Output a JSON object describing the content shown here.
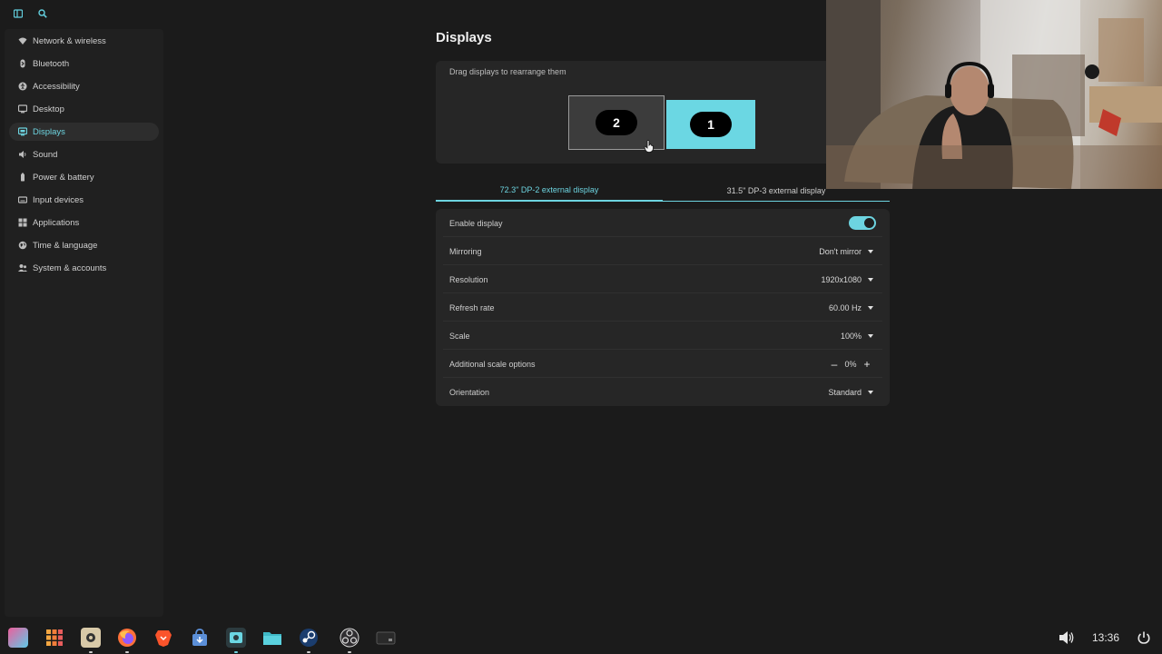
{
  "header": {
    "icons": [
      "sidebar-toggle-icon",
      "search-icon"
    ]
  },
  "sidebar": {
    "items": [
      {
        "label": "Network & wireless",
        "icon": "wifi-icon"
      },
      {
        "label": "Bluetooth",
        "icon": "bluetooth-icon"
      },
      {
        "label": "Accessibility",
        "icon": "accessibility-icon"
      },
      {
        "label": "Desktop",
        "icon": "desktop-icon"
      },
      {
        "label": "Displays",
        "icon": "display-icon",
        "active": true
      },
      {
        "label": "Sound",
        "icon": "sound-icon"
      },
      {
        "label": "Power & battery",
        "icon": "battery-icon"
      },
      {
        "label": "Input devices",
        "icon": "keyboard-icon"
      },
      {
        "label": "Applications",
        "icon": "apps-grid-icon"
      },
      {
        "label": "Time & language",
        "icon": "globe-icon"
      },
      {
        "label": "System & accounts",
        "icon": "accounts-icon"
      }
    ]
  },
  "main": {
    "title": "Displays",
    "arrange": {
      "hint": "Drag displays to rearrange them",
      "monitors": [
        "2",
        "1"
      ]
    },
    "tabs": [
      {
        "label": "72.3\" DP-2 external display",
        "active": true
      },
      {
        "label": "31.5\" DP-3 external display",
        "active": false
      }
    ],
    "settings": {
      "enable_display": {
        "label": "Enable display",
        "enabled": true
      },
      "mirroring": {
        "label": "Mirroring",
        "value": "Don't mirror"
      },
      "resolution": {
        "label": "Resolution",
        "value": "1920x1080"
      },
      "refresh_rate": {
        "label": "Refresh rate",
        "value": "60.00 Hz"
      },
      "scale": {
        "label": "Scale",
        "value": "100%"
      },
      "additional_scale": {
        "label": "Additional scale options",
        "value": "0%",
        "minus": "–",
        "plus": "+"
      },
      "orientation": {
        "label": "Orientation",
        "value": "Standard"
      }
    }
  },
  "taskbar": {
    "apps": [
      "app-launcher-icon",
      "app-grid-icon",
      "settings-app-icon",
      "firefox-icon",
      "brave-icon",
      "store-icon",
      "cosmic-settings-icon",
      "files-icon",
      "steam-icon",
      "obs-icon",
      "terminal-icon"
    ],
    "clock": "13:36"
  },
  "colors": {
    "accent": "#6dd4e0",
    "background": "#1b1b1b",
    "card": "#262626"
  }
}
